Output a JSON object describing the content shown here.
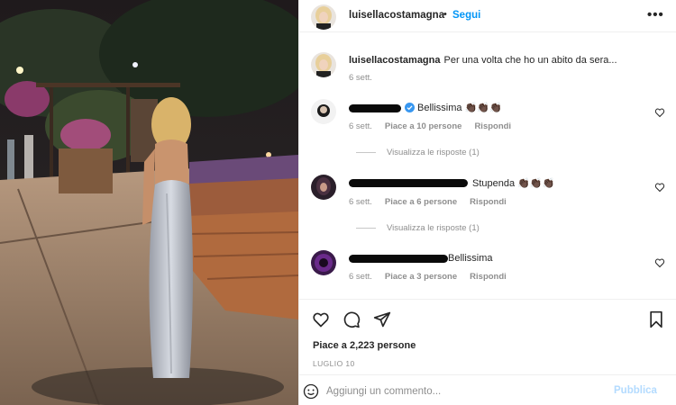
{
  "post": {
    "author": "luisellacostamagna",
    "separator": "•",
    "follow_label": "Segui",
    "more_label": "•••"
  },
  "caption": {
    "username": "luisellacostamagna",
    "text": "Per una volta che ho un abito da sera...",
    "time": "6 sett."
  },
  "comments": [
    {
      "text": "Bellissima 👏🏿👏🏿👏🏿",
      "verified": true,
      "time": "6 sett.",
      "likes": "Piace a 10 persone",
      "reply_label": "Rispondi",
      "view_replies": "Visualizza le risposte (1)"
    },
    {
      "text": "Stupenda 👏🏿👏🏿👏🏿",
      "verified": false,
      "time": "6 sett.",
      "likes": "Piace a 6 persone",
      "reply_label": "Rispondi",
      "view_replies": "Visualizza le risposte (1)"
    },
    {
      "text": "Bellissima",
      "verified": false,
      "time": "6 sett.",
      "likes": "Piace a 3 persone",
      "reply_label": "Rispondi"
    }
  ],
  "footer": {
    "likes": "Piace a 2,223 persone",
    "date": "LUGLIO 10",
    "input_placeholder": "Aggiungi un commento...",
    "publish_label": "Pubblica"
  },
  "colors": {
    "accent": "#0095f6",
    "publish_disabled": "#b3dbff",
    "secondary_text": "#8e8e8e",
    "primary_text": "#262626"
  },
  "icons": [
    "heart-icon",
    "comment-icon",
    "share-icon",
    "bookmark-icon",
    "emoji-icon",
    "verified-icon",
    "more-icon"
  ]
}
